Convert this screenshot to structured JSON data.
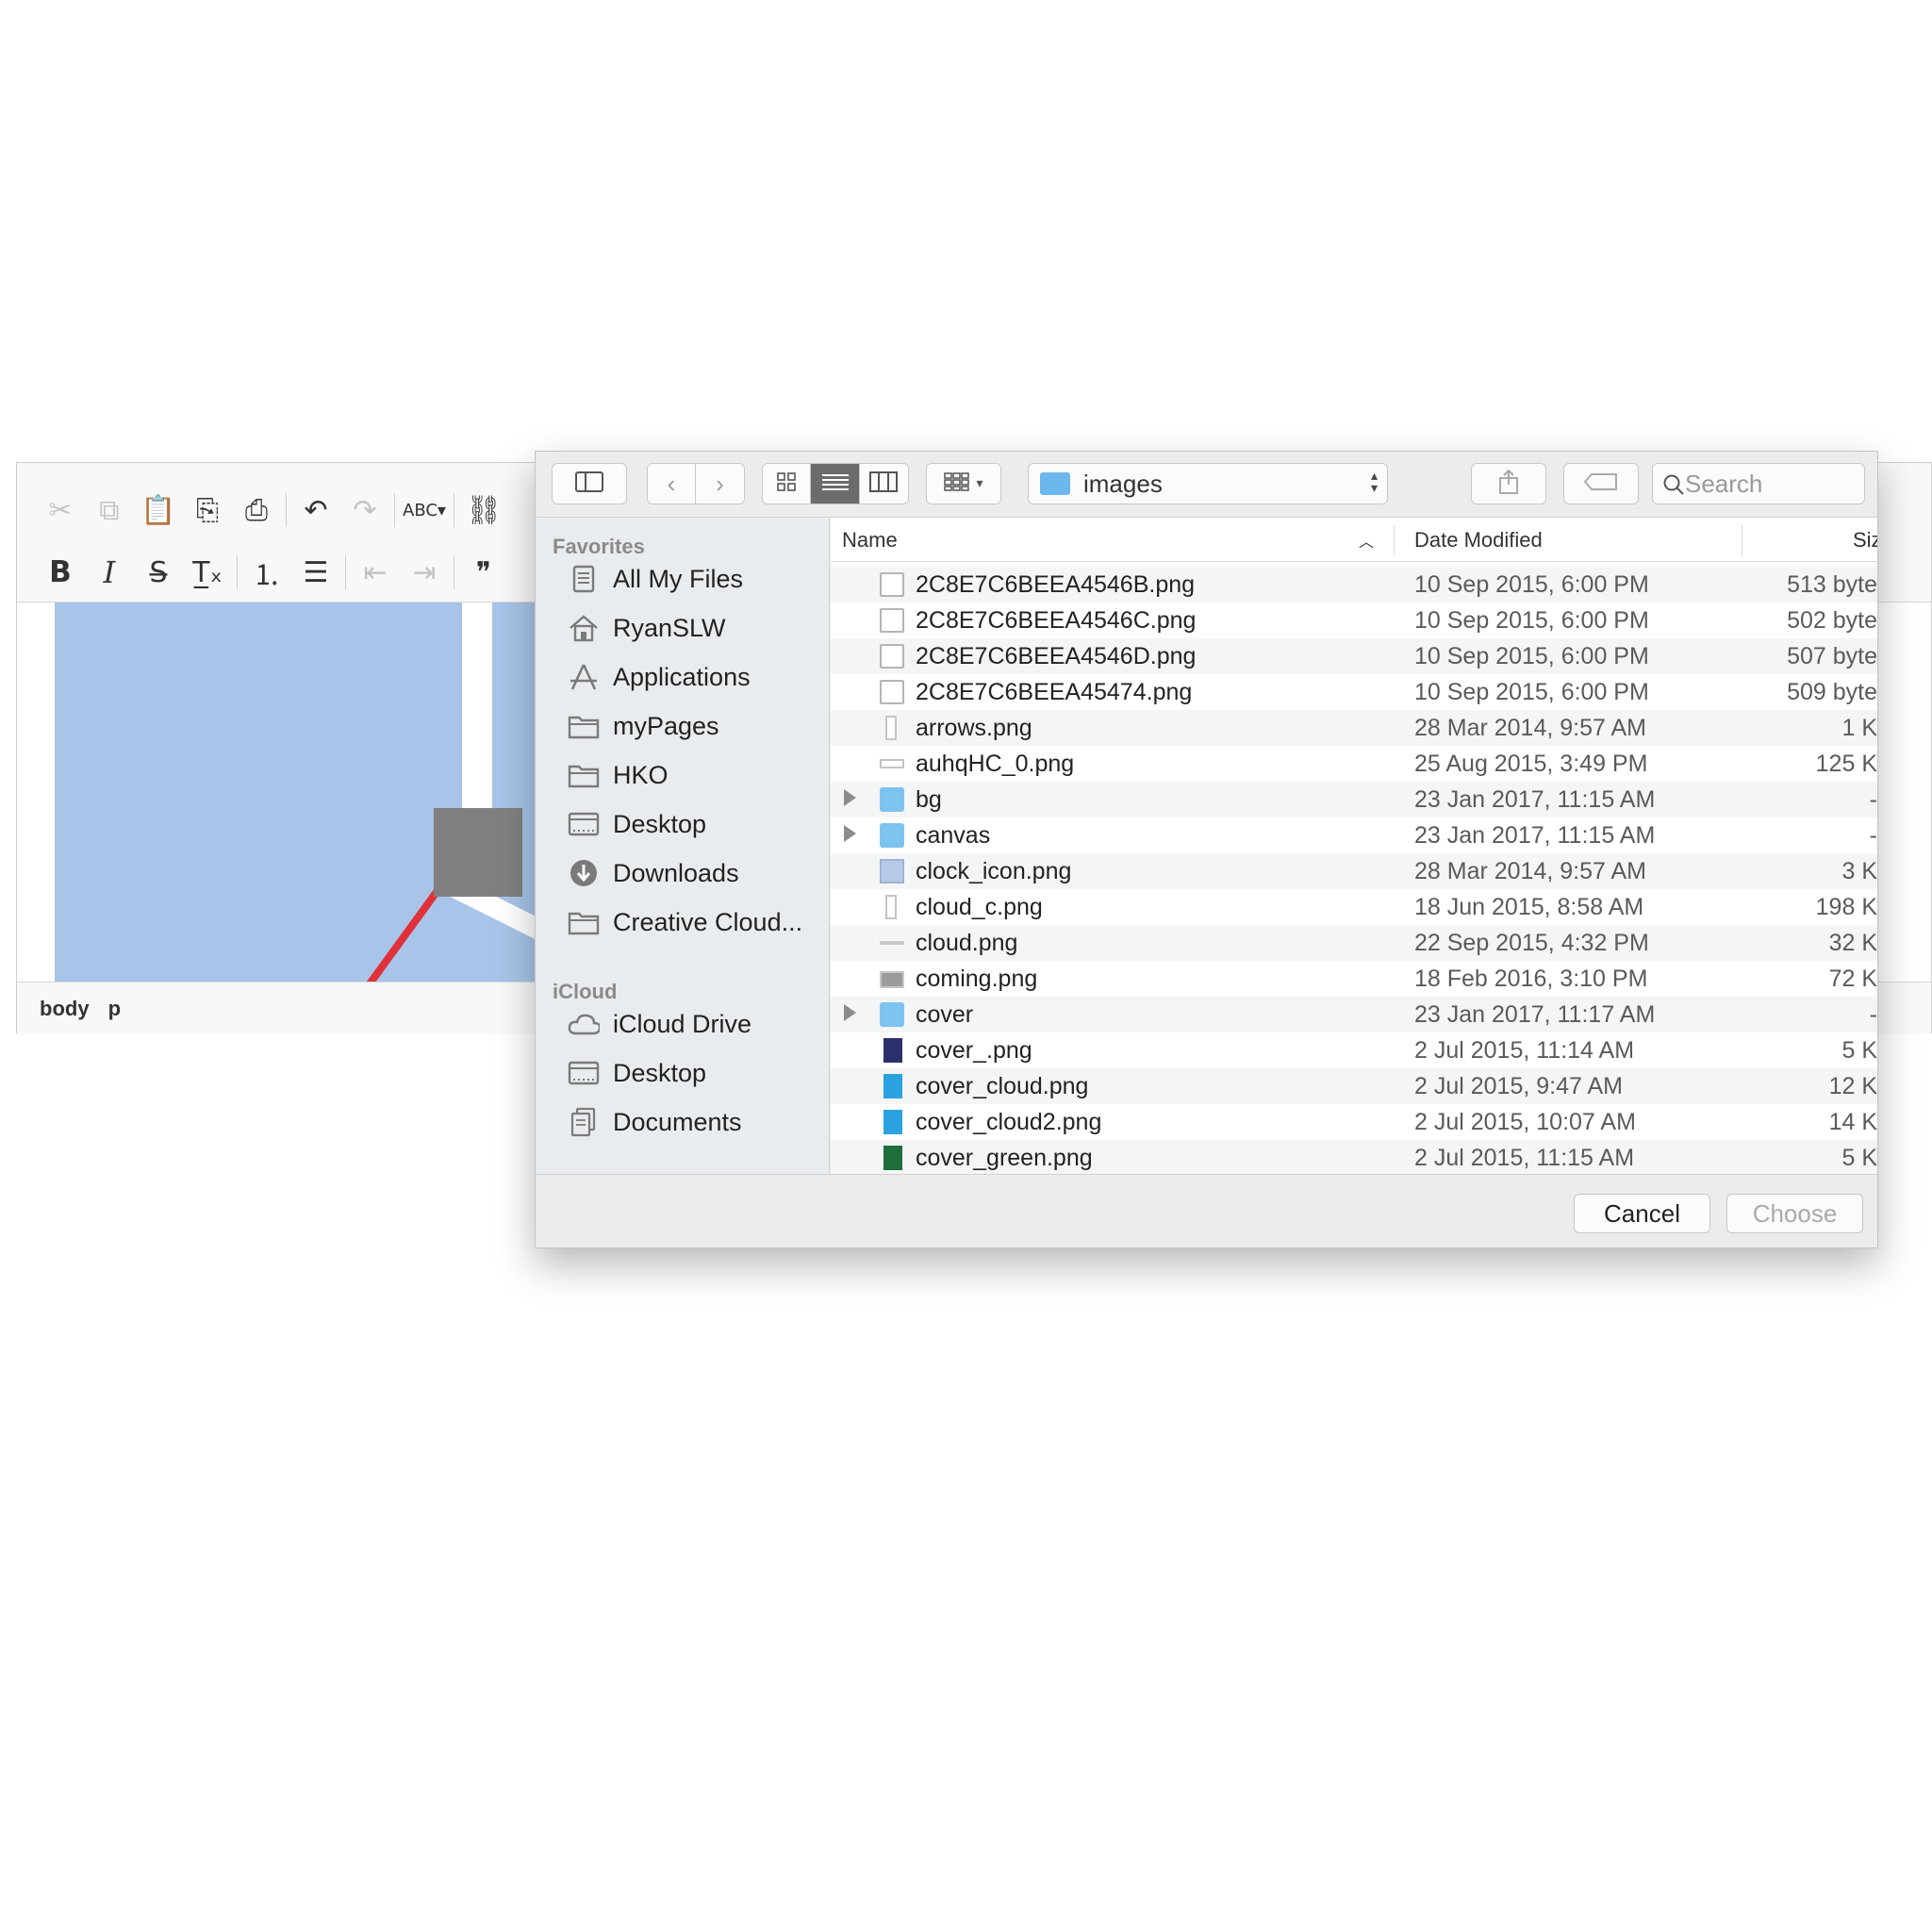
{
  "editor": {
    "toolbar_row1": [
      {
        "icon": "cut-icon",
        "glyph": "✂",
        "disabled": true
      },
      {
        "icon": "copy-icon",
        "glyph": "⧉",
        "disabled": true
      },
      {
        "icon": "paste-icon",
        "glyph": "📋",
        "disabled": false
      },
      {
        "icon": "paste-text-icon",
        "glyph": "⎘",
        "disabled": false
      },
      {
        "icon": "paste-word-icon",
        "glyph": "⎙",
        "disabled": false
      },
      {
        "sep": true
      },
      {
        "icon": "undo-icon",
        "glyph": "↶",
        "disabled": false
      },
      {
        "icon": "redo-icon",
        "glyph": "↷",
        "disabled": true
      },
      {
        "sep": true
      },
      {
        "icon": "spellcheck-icon",
        "glyph": "ABC▾",
        "disabled": false
      },
      {
        "sep": true
      },
      {
        "icon": "link-icon",
        "glyph": "⛓",
        "disabled": false
      }
    ],
    "toolbar_row2": [
      {
        "icon": "bold-icon",
        "glyph": "B",
        "style": "bold",
        "disabled": false
      },
      {
        "icon": "italic-icon",
        "glyph": "I",
        "style": "ital",
        "disabled": false
      },
      {
        "icon": "strikethrough-icon",
        "glyph": "S̶",
        "disabled": false
      },
      {
        "icon": "remove-format-icon",
        "glyph": "T̲ₓ",
        "disabled": false
      },
      {
        "sep": true
      },
      {
        "icon": "numbered-list-icon",
        "glyph": "⒈",
        "disabled": false
      },
      {
        "icon": "bulleted-list-icon",
        "glyph": "☰",
        "disabled": false
      },
      {
        "sep": true
      },
      {
        "icon": "outdent-icon",
        "glyph": "⇤",
        "disabled": true
      },
      {
        "icon": "indent-icon",
        "glyph": "⇥",
        "disabled": true
      },
      {
        "sep": true
      },
      {
        "icon": "blockquote-icon",
        "glyph": "❞",
        "disabled": false
      }
    ],
    "status_path": [
      "body",
      "p"
    ]
  },
  "dialog": {
    "location": "images",
    "search_placeholder": "Search",
    "sidebar": {
      "favorites_heading": "Favorites",
      "favorites": [
        {
          "label": "All My Files",
          "icon": "all-files-icon"
        },
        {
          "label": "RyanSLW",
          "icon": "home-icon"
        },
        {
          "label": "Applications",
          "icon": "applications-icon"
        },
        {
          "label": "myPages",
          "icon": "folder-icon"
        },
        {
          "label": "HKO",
          "icon": "folder-icon"
        },
        {
          "label": "Desktop",
          "icon": "desktop-icon"
        },
        {
          "label": "Downloads",
          "icon": "downloads-icon"
        },
        {
          "label": "Creative Cloud...",
          "icon": "folder-icon"
        }
      ],
      "icloud_heading": "iCloud",
      "icloud": [
        {
          "label": "iCloud Drive",
          "icon": "cloud-icon"
        },
        {
          "label": "Desktop",
          "icon": "desktop-icon"
        },
        {
          "label": "Documents",
          "icon": "documents-icon"
        }
      ]
    },
    "columns": {
      "name": "Name",
      "date": "Date Modified",
      "size": "Siz"
    },
    "files": [
      {
        "name": "2C8E7C6BEEA4546B.png",
        "date": "10 Sep 2015, 6:00 PM",
        "size": "513 byte",
        "icon": "doc",
        "folder": false
      },
      {
        "name": "2C8E7C6BEEA4546C.png",
        "date": "10 Sep 2015, 6:00 PM",
        "size": "502 byte",
        "icon": "doc",
        "folder": false
      },
      {
        "name": "2C8E7C6BEEA4546D.png",
        "date": "10 Sep 2015, 6:00 PM",
        "size": "507 byte",
        "icon": "doc",
        "folder": false
      },
      {
        "name": "2C8E7C6BEEA45474.png",
        "date": "10 Sep 2015, 6:00 PM",
        "size": "509 byte",
        "icon": "doc",
        "folder": false
      },
      {
        "name": "arrows.png",
        "date": "28 Mar 2014, 9:57 AM",
        "size": "1 K",
        "icon": "narrow",
        "folder": false
      },
      {
        "name": "auhqHC_0.png",
        "date": "25 Aug 2015, 3:49 PM",
        "size": "125 K",
        "icon": "wide",
        "folder": false
      },
      {
        "name": "bg",
        "date": "23 Jan 2017, 11:15 AM",
        "size": "-",
        "icon": "folder",
        "folder": true
      },
      {
        "name": "canvas",
        "date": "23 Jan 2017, 11:15 AM",
        "size": "-",
        "icon": "folder",
        "folder": true
      },
      {
        "name": "clock_icon.png",
        "date": "28 Mar 2014, 9:57 AM",
        "size": "3 K",
        "icon": "clock",
        "folder": false
      },
      {
        "name": "cloud_c.png",
        "date": "18 Jun 2015, 8:58 AM",
        "size": "198 K",
        "icon": "narrow",
        "folder": false
      },
      {
        "name": "cloud.png",
        "date": "22 Sep 2015, 4:32 PM",
        "size": "32 K",
        "icon": "thin",
        "folder": false
      },
      {
        "name": "coming.png",
        "date": "18 Feb 2016, 3:10 PM",
        "size": "72 K",
        "icon": "coming",
        "folder": false
      },
      {
        "name": "cover",
        "date": "23 Jan 2017, 11:17 AM",
        "size": "-",
        "icon": "folder",
        "folder": true
      },
      {
        "name": "cover_.png",
        "date": "2 Jul 2015, 11:14 AM",
        "size": "5 K",
        "icon": "navy",
        "folder": false
      },
      {
        "name": "cover_cloud.png",
        "date": "2 Jul 2015, 9:47 AM",
        "size": "12 K",
        "icon": "cyan",
        "folder": false
      },
      {
        "name": "cover_cloud2.png",
        "date": "2 Jul 2015, 10:07 AM",
        "size": "14 K",
        "icon": "cyan",
        "folder": false
      },
      {
        "name": "cover_green.png",
        "date": "2 Jul 2015, 11:15 AM",
        "size": "5 K",
        "icon": "green",
        "folder": false
      }
    ],
    "buttons": {
      "cancel": "Cancel",
      "choose": "Choose"
    }
  }
}
